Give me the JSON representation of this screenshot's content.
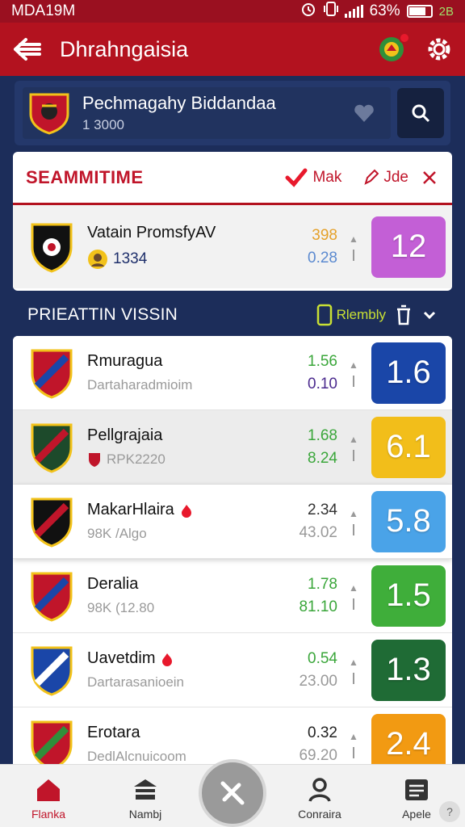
{
  "status_bar": {
    "time": "MDA19M",
    "battery": "63%",
    "battery_level": 0.8,
    "icons": [
      "alarm-icon",
      "vibrate-icon",
      "signal-icon",
      "battery-icon"
    ]
  },
  "app_bar": {
    "title": "Dhrahngaisia"
  },
  "header": {
    "title": "Pechmagahy Biddandaa",
    "subtitle": "1 3000"
  },
  "live": {
    "title": "SEAMMITIME",
    "action_1": "Mak",
    "action_2": "Jde",
    "match": {
      "name": "Vatain PromsfyAV",
      "meta": "1334",
      "odd_1": "398",
      "odd_2": "0.28",
      "score": "12"
    }
  },
  "section": {
    "title": "PRIEATTIN VISSIN",
    "filter_label": "Rlembly"
  },
  "matches": [
    {
      "name": "Rmuragua",
      "meta": "Dartaharadmioim",
      "odd_1": "1.56",
      "odd_2": "0.10",
      "score": "1.6",
      "odd_1_color": "#3aa63a",
      "odd_2_color": "#4b2a8e",
      "score_color": "#1a46a8"
    },
    {
      "name": "Pellgrajaia",
      "meta": "RPK2220",
      "odd_1": "1.68",
      "odd_2": "8.24",
      "score": "6.1",
      "odd_1_color": "#3aa63a",
      "odd_2_color": "#3aa63a",
      "score_color": "#f2be1a"
    },
    {
      "name": "MakarHlaira",
      "meta": "98K /Algo",
      "odd_1": "2.34",
      "odd_2": "43.02",
      "score": "5.8",
      "odd_1_color": "#333333",
      "odd_2_color": "#999999",
      "score_color": "#4aa3e8"
    },
    {
      "name": "Deralia",
      "meta": "98K (12.80",
      "odd_1": "1.78",
      "odd_2": "81.10",
      "score": "1.5",
      "odd_1_color": "#3aa63a",
      "odd_2_color": "#3aa63a",
      "score_color": "#3fae3a"
    },
    {
      "name": "Uavetdim",
      "meta": "Dartarasanioein",
      "odd_1": "0.54",
      "odd_2": "23.00",
      "score": "1.3",
      "odd_1_color": "#3aa63a",
      "odd_2_color": "#999999",
      "score_color": "#1f6b35"
    },
    {
      "name": "Erotara",
      "meta": "DedlAlcnuicoom",
      "odd_1": "0.32",
      "odd_2": "69.20",
      "score": "2.4",
      "odd_1_color": "#222222",
      "odd_2_color": "#999999",
      "score_color": "#f29a12"
    }
  ],
  "bottom_nav": [
    {
      "label": "Flanka",
      "icon": "home-icon",
      "active": true
    },
    {
      "label": "Nambj",
      "icon": "stadium-icon",
      "active": false
    },
    {
      "label": "Conraira",
      "icon": "profile-icon",
      "active": false
    },
    {
      "label": "Apele",
      "icon": "list-icon",
      "active": false
    }
  ],
  "colors": {
    "brand": "#b3121f",
    "navy": "#1c2d5a",
    "live_score": "#c35fd6"
  }
}
